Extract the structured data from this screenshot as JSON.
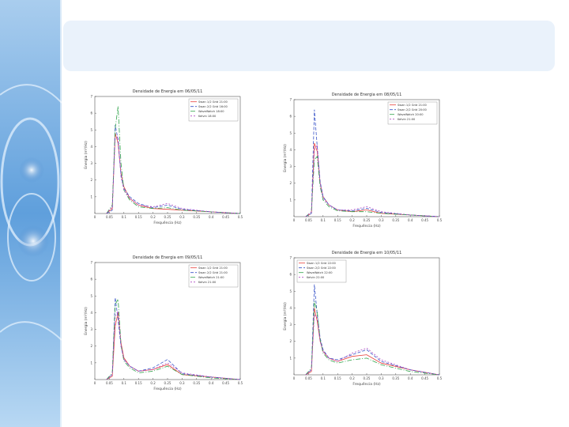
{
  "slide": {
    "title": ""
  },
  "colors": {
    "red": "#e8413c",
    "blue": "#3a55c8",
    "green": "#2fa34a",
    "magenta": "#b04cc4"
  },
  "chart_data": [
    {
      "type": "line",
      "title": "Densidade de Energia em 06/05/11",
      "xlabel": "Frequência (Hz)",
      "ylabel": "Energia (m²/Hz)",
      "xlim": [
        0,
        0.5
      ],
      "ylim": [
        0,
        7
      ],
      "xticks": [
        "0",
        "0.05",
        "0.1",
        "0.15",
        "0.2",
        "0.25",
        "0.3",
        "0.35",
        "0.4",
        "0.45",
        "0.5"
      ],
      "yticks": [
        "1",
        "2",
        "3",
        "4",
        "5",
        "6",
        "7"
      ],
      "legend": {
        "placement": "top-right",
        "entries": [
          "Swan 1/2 Grid 21:00",
          "Swan 2/2 Grid 16:00",
          "WaveWatch 18:00",
          "Kelvin 18:00"
        ]
      },
      "series": [
        {
          "name": "Swan 1/2 Grid 21:00",
          "color": "#e8413c",
          "x": [
            0.04,
            0.06,
            0.07,
            0.08,
            0.09,
            0.1,
            0.12,
            0.15,
            0.2,
            0.25,
            0.3,
            0.4,
            0.5
          ],
          "y": [
            0,
            0.3,
            4.8,
            4.2,
            2.4,
            1.6,
            0.9,
            0.5,
            0.3,
            0.25,
            0.2,
            0.1,
            0
          ]
        },
        {
          "name": "Swan 2/2 Grid 16:00",
          "color": "#3a55c8",
          "x": [
            0.04,
            0.06,
            0.07,
            0.08,
            0.09,
            0.1,
            0.12,
            0.15,
            0.2,
            0.25,
            0.3,
            0.4,
            0.5
          ],
          "y": [
            0,
            0.2,
            5.3,
            4.4,
            2.3,
            1.5,
            1.0,
            0.6,
            0.35,
            0.5,
            0.25,
            0.1,
            0
          ]
        },
        {
          "name": "WaveWatch 18:00",
          "color": "#2fa34a",
          "x": [
            0.04,
            0.06,
            0.07,
            0.08,
            0.09,
            0.1,
            0.12,
            0.15,
            0.2,
            0.25,
            0.3,
            0.4,
            0.5
          ],
          "y": [
            0,
            0.5,
            5.1,
            6.4,
            3.0,
            1.4,
            0.8,
            0.4,
            0.3,
            0.35,
            0.2,
            0.1,
            0
          ]
        },
        {
          "name": "Kelvin 18:00",
          "color": "#b04cc4",
          "x": [
            0.04,
            0.06,
            0.07,
            0.08,
            0.09,
            0.1,
            0.12,
            0.15,
            0.2,
            0.25,
            0.3,
            0.4,
            0.5
          ],
          "y": [
            0,
            0.4,
            4.5,
            4.6,
            2.2,
            1.4,
            0.9,
            0.5,
            0.4,
            0.6,
            0.3,
            0.1,
            0
          ]
        }
      ]
    },
    {
      "type": "line",
      "title": "Densidade de Energia em 08/05/11",
      "xlabel": "Frequência (Hz)",
      "ylabel": "Energia (m²/Hz)",
      "xlim": [
        0,
        0.5
      ],
      "ylim": [
        0,
        7
      ],
      "xticks": [
        "0",
        "0.05",
        "0.1",
        "0.15",
        "0.2",
        "0.25",
        "0.3",
        "0.35",
        "0.4",
        "0.45",
        "0.5"
      ],
      "yticks": [
        "1",
        "2",
        "3",
        "4",
        "5",
        "6",
        "7"
      ],
      "legend": {
        "placement": "top-right",
        "entries": [
          "Swan 1/2 Grid 21:00",
          "Swan 2/2 Grid 20:00",
          "WaveWatch 20:00",
          "Kelvin 21:00"
        ]
      },
      "series": [
        {
          "name": "Swan 1/2 Grid 21:00",
          "color": "#e8413c",
          "x": [
            0.04,
            0.06,
            0.07,
            0.08,
            0.09,
            0.1,
            0.12,
            0.15,
            0.2,
            0.25,
            0.3,
            0.4,
            0.5
          ],
          "y": [
            0,
            0.2,
            4.4,
            3.9,
            2.0,
            1.2,
            0.7,
            0.4,
            0.3,
            0.4,
            0.2,
            0.1,
            0
          ]
        },
        {
          "name": "Swan 2/2 Grid 20:00",
          "color": "#3a55c8",
          "x": [
            0.04,
            0.06,
            0.07,
            0.08,
            0.09,
            0.1,
            0.12,
            0.15,
            0.2,
            0.25,
            0.3,
            0.4,
            0.5
          ],
          "y": [
            0,
            0.2,
            6.4,
            4.2,
            2.1,
            1.2,
            0.7,
            0.4,
            0.35,
            0.5,
            0.25,
            0.1,
            0
          ]
        },
        {
          "name": "WaveWatch 20:00",
          "color": "#2fa34a",
          "x": [
            0.04,
            0.06,
            0.07,
            0.08,
            0.09,
            0.1,
            0.12,
            0.15,
            0.2,
            0.25,
            0.3,
            0.4,
            0.5
          ],
          "y": [
            0,
            0.3,
            3.4,
            3.6,
            1.8,
            1.0,
            0.6,
            0.35,
            0.3,
            0.3,
            0.2,
            0.1,
            0
          ]
        },
        {
          "name": "Kelvin 21:00",
          "color": "#b04cc4",
          "x": [
            0.04,
            0.06,
            0.07,
            0.08,
            0.09,
            0.1,
            0.12,
            0.15,
            0.2,
            0.25,
            0.3,
            0.4,
            0.5
          ],
          "y": [
            0,
            0.3,
            4.0,
            4.3,
            2.0,
            1.1,
            0.7,
            0.4,
            0.4,
            0.6,
            0.3,
            0.1,
            0
          ]
        }
      ]
    },
    {
      "type": "line",
      "title": "Densidade de Energia em 09/05/11",
      "xlabel": "Frequência (Hz)",
      "ylabel": "Energia (m²/Hz)",
      "xlim": [
        0,
        0.5
      ],
      "ylim": [
        0,
        7
      ],
      "xticks": [
        "0",
        "0.05",
        "0.1",
        "0.15",
        "0.2",
        "0.25",
        "0.3",
        "0.35",
        "0.4",
        "0.45",
        "0.5"
      ],
      "yticks": [
        "1",
        "2",
        "3",
        "4",
        "5",
        "6",
        "7"
      ],
      "legend": {
        "placement": "top-right",
        "entries": [
          "Swan 1/2 Grid 21:00",
          "Swan 2/2 Grid 21:00",
          "WaveWatch 21:00",
          "Kelvin 21:00"
        ]
      },
      "series": [
        {
          "name": "Swan 1/2 Grid 21:00",
          "color": "#e8413c",
          "x": [
            0.04,
            0.06,
            0.07,
            0.08,
            0.09,
            0.1,
            0.12,
            0.15,
            0.2,
            0.25,
            0.3,
            0.4,
            0.5
          ],
          "y": [
            0,
            0.2,
            3.2,
            4.0,
            2.2,
            1.3,
            0.8,
            0.5,
            0.6,
            0.9,
            0.3,
            0.15,
            0
          ]
        },
        {
          "name": "Swan 2/2 Grid 21:00",
          "color": "#3a55c8",
          "x": [
            0.04,
            0.06,
            0.07,
            0.08,
            0.09,
            0.1,
            0.12,
            0.15,
            0.2,
            0.25,
            0.3,
            0.4,
            0.5
          ],
          "y": [
            0,
            0.3,
            4.9,
            3.6,
            2.0,
            1.2,
            0.8,
            0.5,
            0.7,
            1.2,
            0.35,
            0.15,
            0
          ]
        },
        {
          "name": "WaveWatch 21:00",
          "color": "#2fa34a",
          "x": [
            0.04,
            0.06,
            0.07,
            0.08,
            0.09,
            0.1,
            0.12,
            0.15,
            0.2,
            0.25,
            0.3,
            0.4,
            0.5
          ],
          "y": [
            0,
            0.4,
            4.5,
            4.8,
            2.1,
            1.1,
            0.7,
            0.4,
            0.5,
            0.8,
            0.3,
            0.1,
            0
          ]
        },
        {
          "name": "Kelvin 21:00",
          "color": "#b04cc4",
          "x": [
            0.04,
            0.06,
            0.07,
            0.08,
            0.09,
            0.1,
            0.12,
            0.15,
            0.2,
            0.25,
            0.3,
            0.4,
            0.5
          ],
          "y": [
            0,
            0.3,
            3.8,
            4.1,
            2.0,
            1.2,
            0.8,
            0.5,
            0.6,
            1.0,
            0.4,
            0.15,
            0
          ]
        }
      ]
    },
    {
      "type": "line",
      "title": "Densidade de Energia em 10/05/11",
      "xlabel": "Frequência (Hz)",
      "ylabel": "Energia (m²/Hz)",
      "xlim": [
        0,
        0.5
      ],
      "ylim": [
        0,
        7
      ],
      "xticks": [
        "0",
        "0.05",
        "0.1",
        "0.15",
        "0.2",
        "0.25",
        "0.3",
        "0.35",
        "0.4",
        "0.45",
        "0.5"
      ],
      "yticks": [
        "1",
        "2",
        "3",
        "4",
        "5",
        "6",
        "7"
      ],
      "legend": {
        "placement": "top-left",
        "entries": [
          "Swan 1/2 Grid 22:00",
          "Swan 2/2 Grid 22:00",
          "WaveWatch 22:00",
          "Kelvin 22:00"
        ]
      },
      "series": [
        {
          "name": "Swan 1/2 Grid 22:00",
          "color": "#e8413c",
          "x": [
            0.04,
            0.06,
            0.07,
            0.08,
            0.09,
            0.1,
            0.12,
            0.15,
            0.2,
            0.25,
            0.3,
            0.4,
            0.5
          ],
          "y": [
            0,
            0.2,
            4.0,
            3.2,
            2.0,
            1.4,
            1.0,
            0.8,
            1.1,
            1.2,
            0.7,
            0.3,
            0
          ]
        },
        {
          "name": "Swan 2/2 Grid 22:00",
          "color": "#3a55c8",
          "x": [
            0.04,
            0.06,
            0.07,
            0.08,
            0.09,
            0.1,
            0.12,
            0.15,
            0.2,
            0.25,
            0.3,
            0.4,
            0.5
          ],
          "y": [
            0,
            0.3,
            5.4,
            3.6,
            2.2,
            1.5,
            1.0,
            0.9,
            1.2,
            1.5,
            0.8,
            0.3,
            0
          ]
        },
        {
          "name": "WaveWatch 22:00",
          "color": "#2fa34a",
          "x": [
            0.04,
            0.06,
            0.07,
            0.08,
            0.09,
            0.1,
            0.12,
            0.15,
            0.2,
            0.25,
            0.3,
            0.4,
            0.5
          ],
          "y": [
            0,
            0.4,
            4.4,
            3.8,
            2.1,
            1.3,
            0.9,
            0.7,
            0.9,
            1.0,
            0.6,
            0.2,
            0
          ]
        },
        {
          "name": "Kelvin 22:00",
          "color": "#b04cc4",
          "x": [
            0.04,
            0.06,
            0.07,
            0.08,
            0.09,
            0.1,
            0.12,
            0.15,
            0.2,
            0.25,
            0.3,
            0.4,
            0.5
          ],
          "y": [
            0,
            0.3,
            3.6,
            3.4,
            2.0,
            1.4,
            1.0,
            0.8,
            1.3,
            1.6,
            0.9,
            0.3,
            0
          ]
        }
      ]
    }
  ]
}
